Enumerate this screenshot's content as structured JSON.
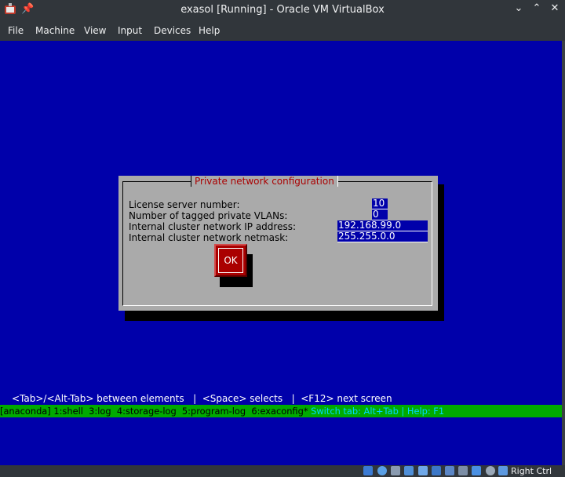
{
  "window": {
    "title": "exasol [Running] - Oracle VM VirtualBox",
    "icons": [
      "virtualbox-icon",
      "pin-icon",
      "chevron-down-icon",
      "chevron-up-icon",
      "close-icon"
    ]
  },
  "menubar": {
    "items": [
      "File",
      "Machine",
      "View",
      "Input",
      "Devices",
      "Help"
    ]
  },
  "dialog": {
    "title": "Private network configuration",
    "fields": [
      {
        "label": "License server number:",
        "value": "10"
      },
      {
        "label": "Number of tagged private VLANs:",
        "value": "0"
      },
      {
        "label": "Internal cluster network IP address:",
        "value": "192.168.99.0"
      },
      {
        "label": "Internal cluster network netmask:",
        "value": "255.255.0.0"
      }
    ],
    "ok_label": "OK"
  },
  "helpline": "<Tab>/<Alt-Tab> between elements   |  <Space> selects   |  <F12> next screen",
  "tmux": {
    "windows": "[anaconda] 1:shell  3:log  4:storage-log  5:program-log  6:exaconfig*",
    "hint": " Switch tab: Alt+Tab | Help: F1"
  },
  "statusbar": {
    "host_key": "Right Ctrl",
    "icons": [
      "hdd-icon",
      "optical-icon",
      "usb-icon",
      "network-icon",
      "shared-folder-icon",
      "display-icon",
      "recording-icon",
      "cpu-icon",
      "mouse-icon",
      "arrow-icon"
    ]
  },
  "colors": {
    "console_bg": "#0000aa",
    "dialog_bg": "#aaaaaa",
    "title_red": "#aa0000",
    "tmux_green": "#00aa00"
  }
}
